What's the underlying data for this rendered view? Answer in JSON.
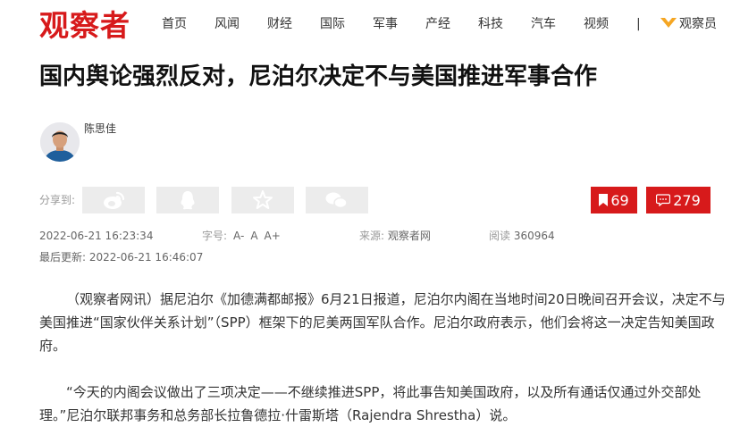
{
  "site": {
    "logo_text": "观察者"
  },
  "nav": {
    "items": [
      "首页",
      "风闻",
      "财经",
      "国际",
      "军事",
      "产经",
      "科技",
      "汽车",
      "视频"
    ],
    "separator": "|",
    "member_label": "观察员"
  },
  "article": {
    "title": "国内舆论强烈反对，尼泊尔决定不与美国推进军事合作",
    "author": "陈思佳",
    "share_label": "分享到:",
    "share_icons": [
      "weibo-icon",
      "qq-icon",
      "qzone-star-icon",
      "wechat-icon"
    ],
    "bookmark_count": "69",
    "comment_count": "279",
    "meta": {
      "published": "2022-06-21 16:23:34",
      "font_size_label": "字号:",
      "font_size_options": [
        "A-",
        "A",
        "A+"
      ],
      "source_label": "来源:",
      "source": "观察者网",
      "reads_label": "阅读",
      "reads": "360964",
      "updated_label": "最后更新:",
      "updated": "2022-06-21 16:46:07"
    },
    "paragraphs": [
      "（观察者网讯）据尼泊尔《加德满都邮报》6月21日报道，尼泊尔内阁在当地时间20日晚间召开会议，决定不与美国推进“国家伙伴关系计划”（SPP）框架下的尼美两国军队合作。尼泊尔政府表示，他们会将这一决定告知美国政府。",
      "“今天的内阁会议做出了三项决定——不继续推进SPP，将此事告知美国政府，以及所有通话仅通过外交部处理。”尼泊尔联邦事务和总务部长拉鲁德拉·什雷斯塔（Rajendra Shrestha）说。"
    ]
  },
  "colors": {
    "brand_red": "#d71a1b",
    "member_icon": "#f5a623",
    "share_bg": "#ececec"
  }
}
